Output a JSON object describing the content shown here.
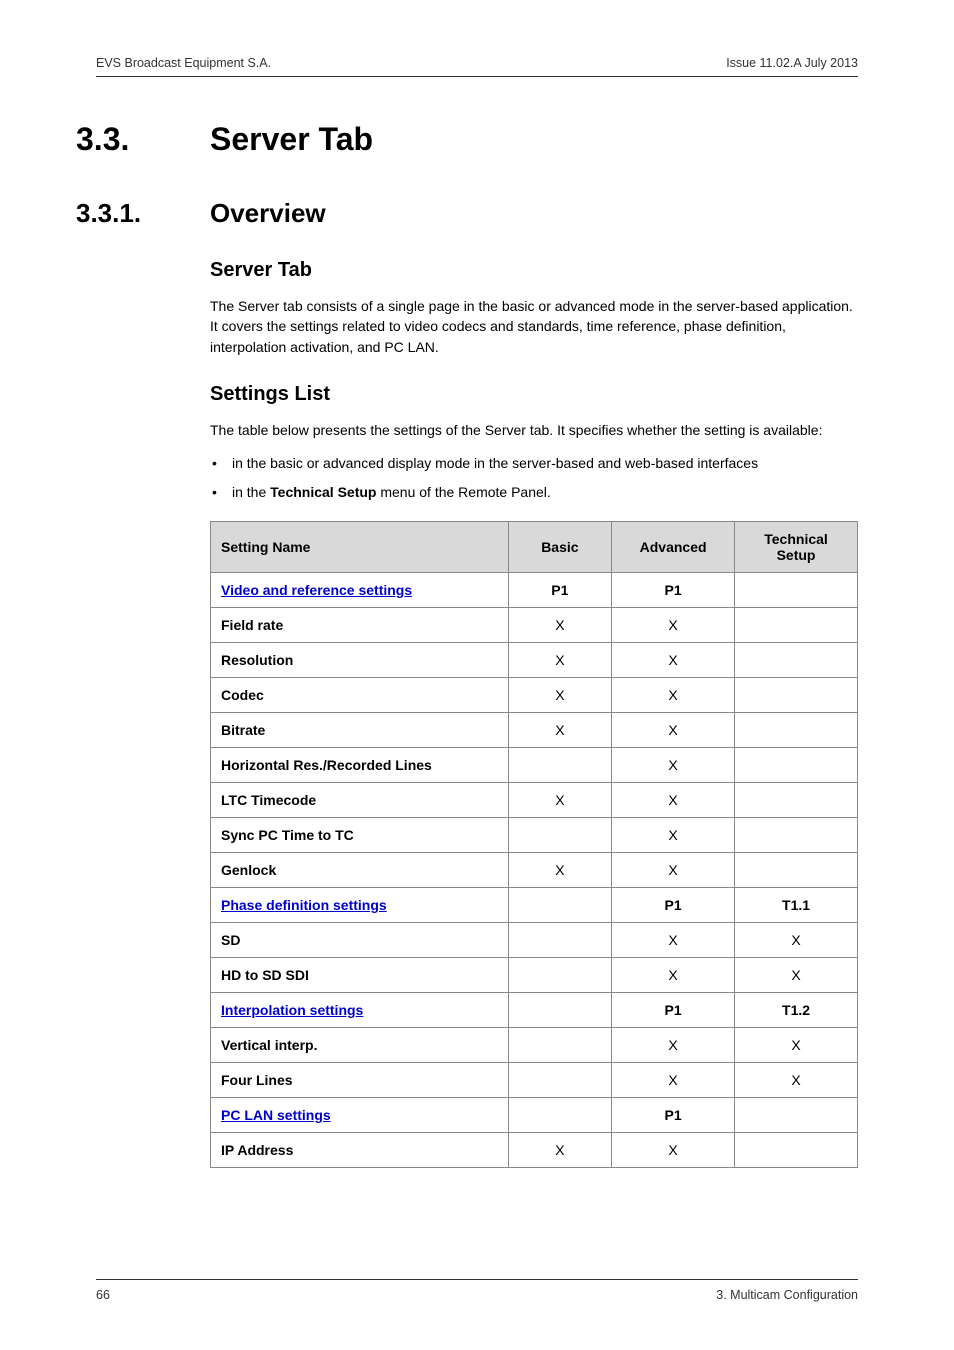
{
  "header": {
    "left": "EVS Broadcast Equipment S.A.",
    "right": "Issue 11.02.A  July 2013"
  },
  "h1": {
    "num": "3.3.",
    "title": "Server Tab"
  },
  "h2": {
    "num": "3.3.1.",
    "title": "Overview"
  },
  "section1": {
    "heading": "Server Tab",
    "para": "The Server tab consists of a single page in the basic or advanced mode in the server-based application. It covers the settings related to video codecs and standards, time reference, phase definition, interpolation activation, and PC LAN."
  },
  "section2": {
    "heading": "Settings List",
    "para": "The table below presents the settings of the Server tab. It specifies whether the setting is available:",
    "bullets": [
      "in the basic or advanced display mode in the server-based and web-based interfaces",
      "in the Technical Setup menu of the Remote Panel."
    ],
    "bullet2_prefix": "in the ",
    "bullet2_bold": "Technical Setup",
    "bullet2_suffix": " menu of the Remote Panel."
  },
  "table": {
    "headers": [
      "Setting Name",
      "Basic",
      "Advanced",
      "Technical Setup"
    ],
    "rows": [
      {
        "name": "Video and reference settings",
        "basic": "P1",
        "advanced": "P1",
        "tech": "",
        "link": true
      },
      {
        "name": "Field rate",
        "basic": "X",
        "advanced": "X",
        "tech": ""
      },
      {
        "name": "Resolution",
        "basic": "X",
        "advanced": "X",
        "tech": ""
      },
      {
        "name": "Codec",
        "basic": "X",
        "advanced": "X",
        "tech": ""
      },
      {
        "name": "Bitrate",
        "basic": "X",
        "advanced": "X",
        "tech": ""
      },
      {
        "name": "Horizontal Res./Recorded Lines",
        "basic": "",
        "advanced": "X",
        "tech": ""
      },
      {
        "name": "LTC Timecode",
        "basic": "X",
        "advanced": "X",
        "tech": ""
      },
      {
        "name": "Sync PC Time to TC",
        "basic": "",
        "advanced": "X",
        "tech": ""
      },
      {
        "name": "Genlock",
        "basic": "X",
        "advanced": "X",
        "tech": ""
      },
      {
        "name": "Phase definition settings",
        "basic": "",
        "advanced": "P1",
        "tech": "T1.1",
        "link": true
      },
      {
        "name": "SD",
        "basic": "",
        "advanced": "X",
        "tech": "X"
      },
      {
        "name": "HD to SD SDI",
        "basic": "",
        "advanced": "X",
        "tech": "X"
      },
      {
        "name": "Interpolation settings",
        "basic": "",
        "advanced": "P1",
        "tech": "T1.2",
        "link": true
      },
      {
        "name": "Vertical interp.",
        "basic": "",
        "advanced": "X",
        "tech": "X"
      },
      {
        "name": "Four Lines",
        "basic": "",
        "advanced": "X",
        "tech": "X"
      },
      {
        "name": "PC LAN settings",
        "basic": "",
        "advanced": "P1",
        "tech": "",
        "link": true
      },
      {
        "name": "IP Address",
        "basic": "X",
        "advanced": "X",
        "tech": ""
      }
    ]
  },
  "footer": {
    "left": "66",
    "right": "3. Multicam Configuration"
  }
}
